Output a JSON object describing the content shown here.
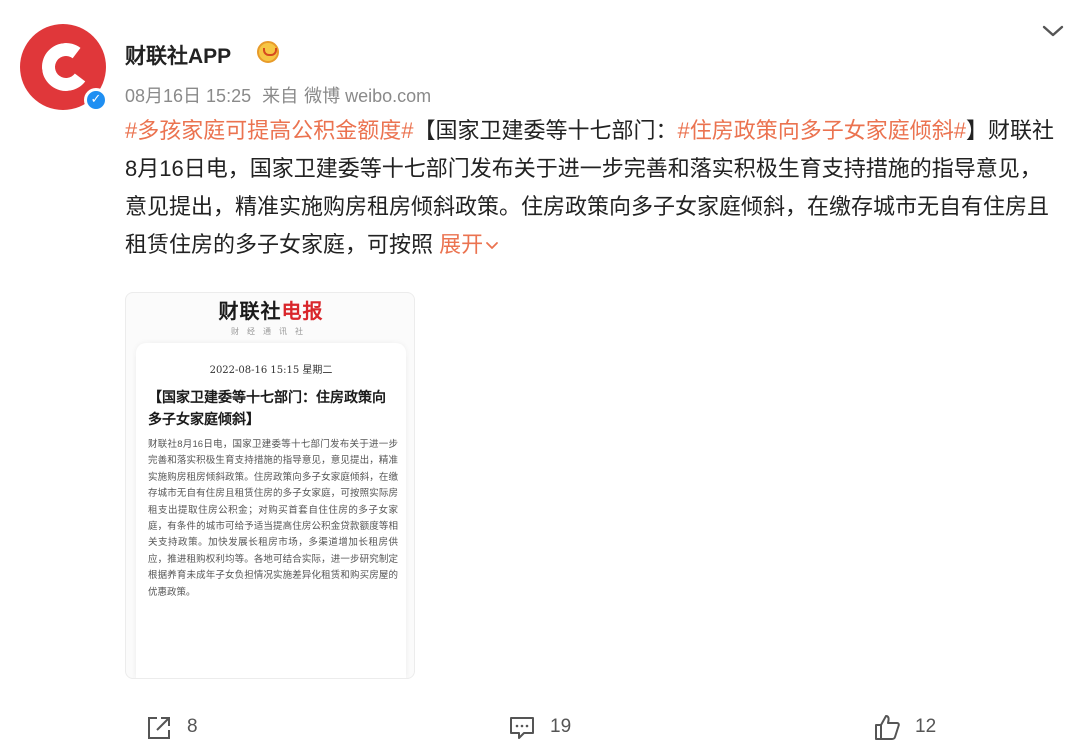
{
  "post": {
    "username": "财联社APP",
    "timestamp": "08月16日 15:25",
    "source_prefix": "来自",
    "source_name": "微博 weibo.com",
    "text_parts": {
      "tag1": "#多孩家庭可提高公积金额度#",
      "bracket_open": "【国家卫建委等十七部门：",
      "tag2": "#住房政策向多子女家庭倾斜#",
      "body": "】财联社8月16日电，国家卫建委等十七部门发布关于进一步完善和落实积极生育支持措施的指导意见，意见提出，精准实施购房租房倾斜政策。住房政策向多子女家庭倾斜，在缴存城市无自有住房且租赁住房的多子女家庭，可按照"
    },
    "expand_label": "展开"
  },
  "card": {
    "brand_black": "财联社",
    "brand_red": "电报",
    "sub": "财经通讯社",
    "date": "2022-08-16 15:15 星期二",
    "title": "【国家卫建委等十七部门：住房政策向多子女家庭倾斜】",
    "body": "财联社8月16日电，国家卫建委等十七部门发布关于进一步完善和落实积极生育支持措施的指导意见，意见提出，精准实施购房租房倾斜政策。住房政策向多子女家庭倾斜，在缴存城市无自有住房且租赁住房的多子女家庭，可按照实际房租支出提取住房公积金；对购买首套自住住房的多子女家庭，有条件的城市可给予适当提高住房公积金贷款额度等相关支持政策。加快发展长租房市场，多渠道增加长租房供应，推进租购权利均等。各地可结合实际，进一步研究制定根据养育未成年子女负担情况实施差异化租赁和购买房屋的优惠政策。"
  },
  "actions": {
    "share_count": "8",
    "comment_count": "19",
    "like_count": "12"
  },
  "colors": {
    "accent": "#eb7350",
    "avatar_red": "#e0373a",
    "verified_blue": "#1f8ff2",
    "meta_gray": "#8a8a8a"
  },
  "icons": {
    "avatar": "cailianshe-logo",
    "verified": "verified-badge-icon",
    "vip": "vip-crown-icon",
    "top_right": "chevron-down-icon",
    "share": "share-icon",
    "comment": "comment-icon",
    "like": "thumbs-up-icon"
  }
}
